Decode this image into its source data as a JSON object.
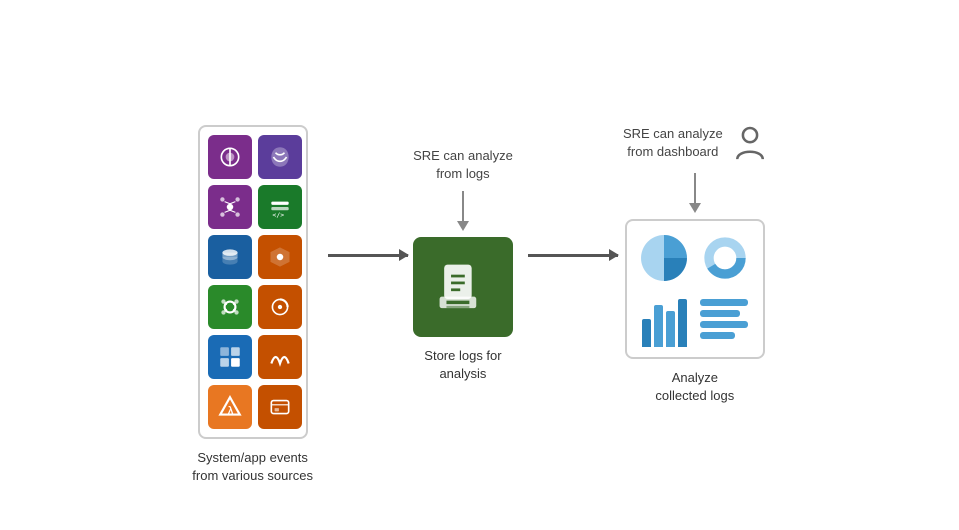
{
  "annotations": {
    "sources_top": "",
    "log_store_top": "SRE can analyze\nfrom logs",
    "dashboard_top": "SRE can analyze\nfrom dashboard",
    "sources_label": "System/app events\nfrom various sources",
    "log_store_label": "Store logs for\nanalysis",
    "dashboard_label": "Analyze\ncollected logs"
  },
  "colors": {
    "bg": "#ffffff",
    "arrow": "#555555",
    "log_store_bg": "#3a6b2a",
    "tile1": "#7b2d8b",
    "tile2": "#5b2d8b",
    "tile3": "#7b2d8b",
    "tile4": "#1a7a2a",
    "tile5": "#c45000",
    "tile6": "#c45000",
    "tile7": "#1a6bb5",
    "tile8": "#c45000",
    "tile9": "#c45000",
    "tile10": "#1a6bb5",
    "tile11": "#e87722",
    "tile12": "#c45000",
    "pie_blue": "#4a9fd4",
    "pie_light": "#a8d4f0",
    "bar_blue": "#4a9fd4"
  }
}
